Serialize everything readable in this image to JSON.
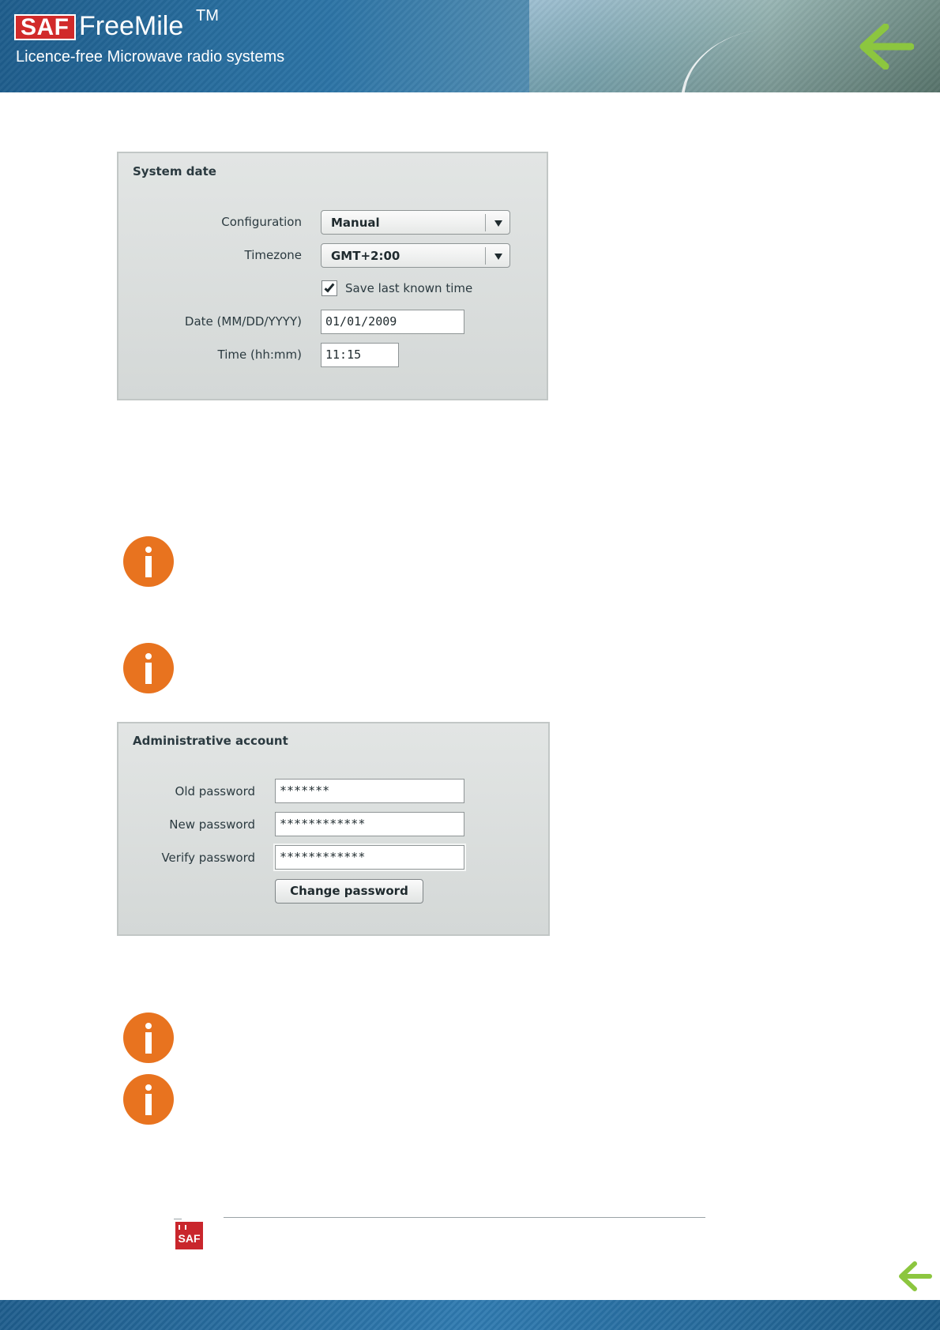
{
  "header": {
    "logo_mark": "SAF",
    "product_name": "FreeMile",
    "trademark": "TM",
    "tagline": "Licence-free Microwave radio systems",
    "back_icon": "back-arrow-icon",
    "accent_color": "#8cc63f"
  },
  "system_date": {
    "title": "System date",
    "configuration_label": "Configuration",
    "configuration_value": "Manual",
    "timezone_label": "Timezone",
    "timezone_value": "GMT+2:00",
    "save_last_known_time_label": "Save last known time",
    "save_last_known_time_checked": true,
    "date_label": "Date (MM/DD/YYYY)",
    "date_value": "01/01/2009",
    "time_label": "Time (hh:mm)",
    "time_value": "11:15"
  },
  "admin_account": {
    "title": "Administrative account",
    "old_password_label": "Old password",
    "old_password_value": "*******",
    "new_password_label": "New password",
    "new_password_value": "************",
    "verify_password_label": "Verify password",
    "verify_password_value": "************",
    "change_button": "Change password"
  },
  "notes": {
    "icon": "info-icon",
    "icon_color": "#e8731f"
  },
  "footer": {
    "logo_mark": "SAF"
  }
}
